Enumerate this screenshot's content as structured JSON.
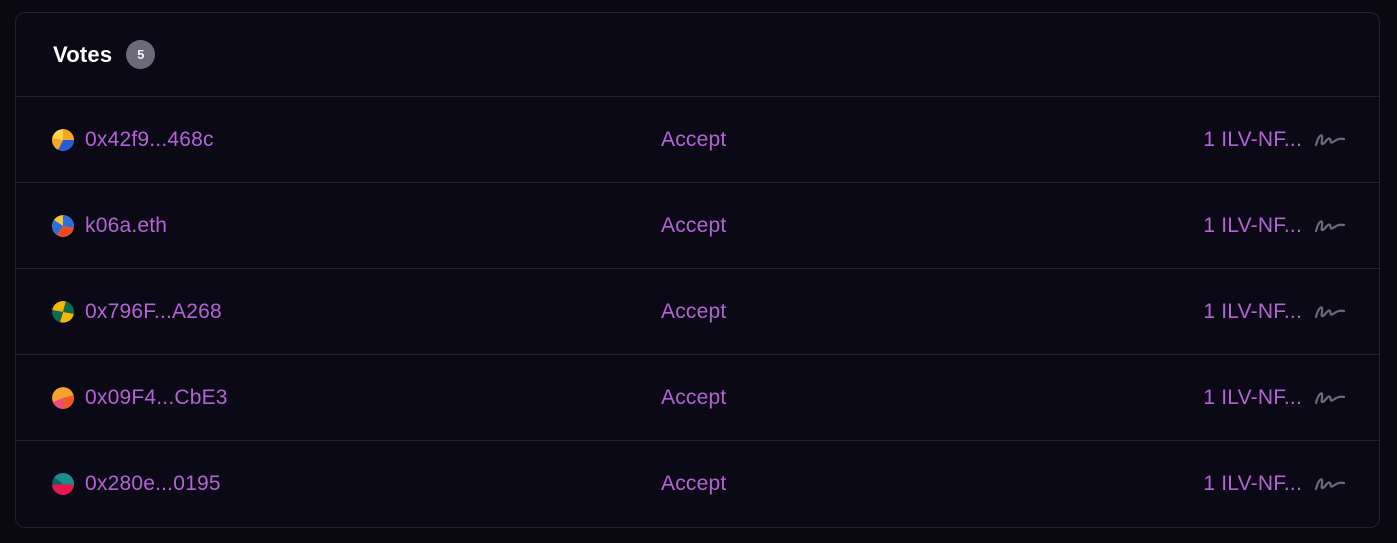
{
  "votes": {
    "title": "Votes",
    "count": "5",
    "rows": [
      {
        "voter": "0x42f9...468c",
        "choice": "Accept",
        "amount": "1 ILV-NF...",
        "avatar_colors": [
          "#f5a623",
          "#2a5bd7",
          "#ffd34d"
        ]
      },
      {
        "voter": "k06a.eth",
        "choice": "Accept",
        "amount": "1 ILV-NF...",
        "avatar_colors": [
          "#2a6fdb",
          "#f04a23",
          "#f7c531"
        ]
      },
      {
        "voter": "0x796F...A268",
        "choice": "Accept",
        "amount": "1 ILV-NF...",
        "avatar_colors": [
          "#0e6b52",
          "#f5b800",
          "#1d3f8f"
        ]
      },
      {
        "voter": "0x09F4...CbE3",
        "choice": "Accept",
        "amount": "1 ILV-NF...",
        "avatar_colors": [
          "#f7a12e",
          "#ef5b2a",
          "#f04a7a"
        ]
      },
      {
        "voter": "0x280e...0195",
        "choice": "Accept",
        "amount": "1 ILV-NF...",
        "avatar_colors": [
          "#e8174d",
          "#1a8f8a",
          "#0f5f6e"
        ]
      }
    ]
  },
  "icons": {
    "signature": "signature-icon"
  },
  "colors": {
    "accent": "#b463d6",
    "background": "#0b0915",
    "border": "#25222f",
    "badge": "#6c6a78"
  }
}
